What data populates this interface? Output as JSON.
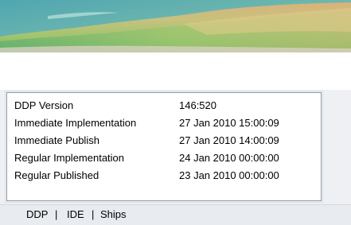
{
  "banner": {
    "image": "terrain-relief-map"
  },
  "version_info": {
    "rows": [
      {
        "label": "DDP Version",
        "value": "146:520"
      },
      {
        "label": "Immediate Implementation",
        "value": "27 Jan 2010 15:00:09"
      },
      {
        "label": "Immediate Publish",
        "value": "27 Jan 2010 14:00:09"
      },
      {
        "label": "Regular Implementation",
        "value": "24 Jan 2010 00:00:00"
      },
      {
        "label": "Regular Published",
        "value": "23 Jan 2010 00:00:00"
      }
    ]
  },
  "tabs": {
    "items": [
      {
        "label": "DDP"
      },
      {
        "label": "IDE"
      },
      {
        "label": "Ships"
      }
    ],
    "separator": "|"
  }
}
